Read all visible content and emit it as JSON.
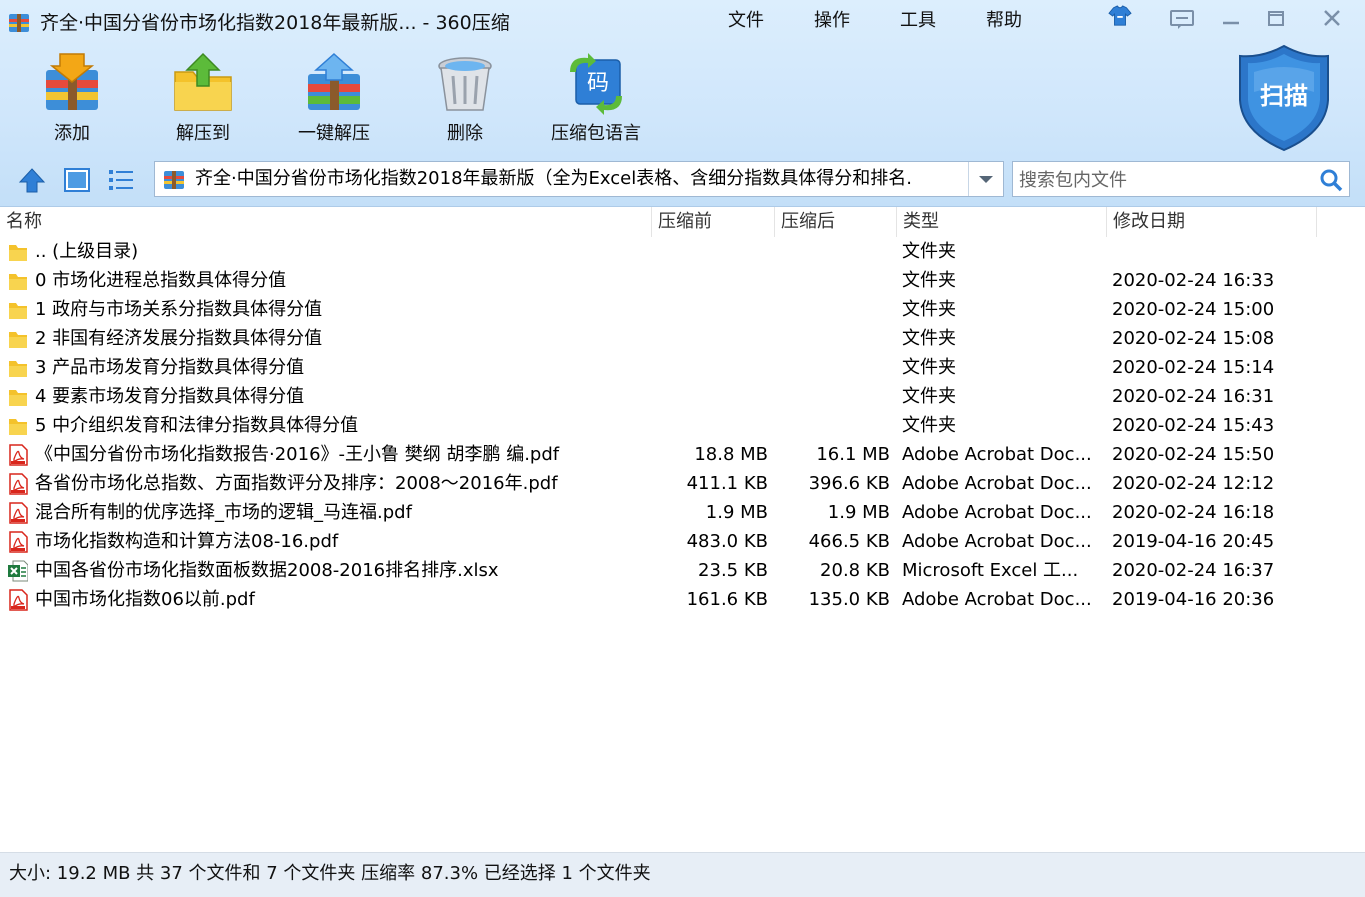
{
  "window": {
    "title": "齐全·中国分省份市场化指数2018年最新版... - 360压缩",
    "menu": [
      "文件",
      "操作",
      "工具",
      "帮助"
    ]
  },
  "toolbar": {
    "add_label": "添加",
    "extract_to_label": "解压到",
    "one_click_extract_label": "一键解压",
    "delete_label": "删除",
    "archive_language_label": "压缩包语言",
    "archive_language_icon_text": "码",
    "scan_label": "扫描"
  },
  "nav": {
    "path": "齐全·中国分省份市场化指数2018年最新版（全为Excel表格、含细分指数具体得分和排名.",
    "search_placeholder": "搜索包内文件"
  },
  "columns": {
    "name": "名称",
    "size_before": "压缩前",
    "size_after": "压缩后",
    "type": "类型",
    "modified": "修改日期"
  },
  "files": [
    {
      "icon": "folder",
      "name": ".. (上级目录)",
      "size_before": "",
      "size_after": "",
      "type": "文件夹",
      "modified": ""
    },
    {
      "icon": "folder",
      "name": "0 市场化进程总指数具体得分值",
      "size_before": "",
      "size_after": "",
      "type": "文件夹",
      "modified": "2020-02-24 16:33"
    },
    {
      "icon": "folder",
      "name": "1 政府与市场关系分指数具体得分值",
      "size_before": "",
      "size_after": "",
      "type": "文件夹",
      "modified": "2020-02-24 15:00"
    },
    {
      "icon": "folder",
      "name": "2 非国有经济发展分指数具体得分值",
      "size_before": "",
      "size_after": "",
      "type": "文件夹",
      "modified": "2020-02-24 15:08"
    },
    {
      "icon": "folder",
      "name": "3 产品市场发育分指数具体得分值",
      "size_before": "",
      "size_after": "",
      "type": "文件夹",
      "modified": "2020-02-24 15:14"
    },
    {
      "icon": "folder",
      "name": "4 要素市场发育分指数具体得分值",
      "size_before": "",
      "size_after": "",
      "type": "文件夹",
      "modified": "2020-02-24 16:31"
    },
    {
      "icon": "folder",
      "name": "5 中介组织发育和法律分指数具体得分值",
      "size_before": "",
      "size_after": "",
      "type": "文件夹",
      "modified": "2020-02-24 15:43"
    },
    {
      "icon": "pdf",
      "name": "《中国分省份市场化指数报告·2016》-王小鲁 樊纲 胡李鹏 编.pdf",
      "size_before": "18.8 MB",
      "size_after": "16.1 MB",
      "type": "Adobe Acrobat Doc...",
      "modified": "2020-02-24 15:50"
    },
    {
      "icon": "pdf",
      "name": "各省份市场化总指数、方面指数评分及排序：2008～2016年.pdf",
      "size_before": "411.1 KB",
      "size_after": "396.6 KB",
      "type": "Adobe Acrobat Doc...",
      "modified": "2020-02-24 12:12"
    },
    {
      "icon": "pdf",
      "name": "混合所有制的优序选择_市场的逻辑_马连福.pdf",
      "size_before": "1.9 MB",
      "size_after": "1.9 MB",
      "type": "Adobe Acrobat Doc...",
      "modified": "2020-02-24 16:18"
    },
    {
      "icon": "pdf",
      "name": "市场化指数构造和计算方法08-16.pdf",
      "size_before": "483.0 KB",
      "size_after": "466.5 KB",
      "type": "Adobe Acrobat Doc...",
      "modified": "2019-04-16 20:45"
    },
    {
      "icon": "excel",
      "name": "中国各省份市场化指数面板数据2008-2016排名排序.xlsx",
      "size_before": "23.5 KB",
      "size_after": "20.8 KB",
      "type": "Microsoft Excel 工...",
      "modified": "2020-02-24 16:37"
    },
    {
      "icon": "pdf",
      "name": "中国市场化指数06以前.pdf",
      "size_before": "161.6 KB",
      "size_after": "135.0 KB",
      "type": "Adobe Acrobat Doc...",
      "modified": "2019-04-16 20:36"
    }
  ],
  "status": {
    "text": "大小: 19.2 MB 共 37 个文件和 7 个文件夹 压缩率 87.3% 已经选择 1 个文件夹"
  },
  "colors": {
    "accent_blue": "#2f7fd6",
    "folder_yellow": "#f4c22b",
    "pdf_red": "#d9261c",
    "excel_green": "#1f7a3e"
  }
}
